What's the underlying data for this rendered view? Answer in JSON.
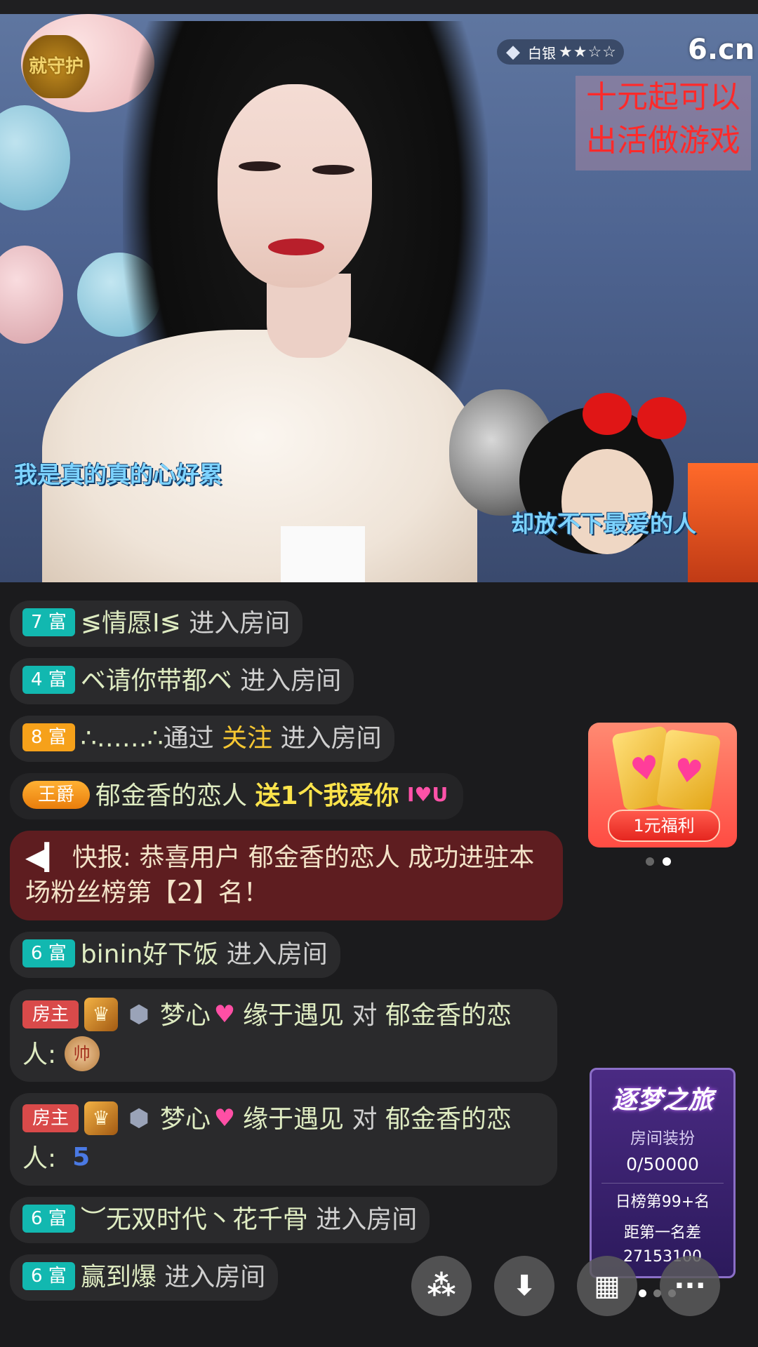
{
  "video": {
    "logo_text": "就守护",
    "rank_label": "白银",
    "rank_stars": "★★☆☆",
    "site": "6.cn",
    "promo_line1": "十元起可以",
    "promo_line2": "出活做游戏",
    "lyric_left": "我是真的真的心好累",
    "lyric_right": "却放不下最爱的人"
  },
  "chat": {
    "m1": {
      "level": "7 富",
      "user": "≶情愿I≶",
      "action": "进入房间"
    },
    "m2": {
      "level": "4 富",
      "user": "ベ请你带都ベ",
      "action": "进入房间"
    },
    "m3": {
      "level": "8 富",
      "user": "∴……∴",
      "via": "通过",
      "source": "关注",
      "action": "进入房间"
    },
    "m4": {
      "title": "王爵",
      "user": "郁金香的恋人",
      "gift": "送1个我爱你",
      "gift_icon": "I♥U"
    },
    "m5": {
      "icon": "◀▎",
      "text": "快报: 恭喜用户 郁金香的恋人 成功进驻本场粉丝榜第【2】名！"
    },
    "m6": {
      "level": "6 富",
      "user": "binin好下饭",
      "action": "进入房间"
    },
    "m7": {
      "role": "房主",
      "user": "梦心",
      "user2": "缘于遇见",
      "to": "对",
      "target": "郁金香的恋人:",
      "gift_glyph": "帅"
    },
    "m8": {
      "role": "房主",
      "user": "梦心",
      "user2": "缘于遇见",
      "to": "对",
      "target": "郁金香的恋人:",
      "gift_glyph": "5"
    },
    "m9": {
      "level": "6 富",
      "user": "︶无双时代丶花千骨",
      "action": "进入房间"
    },
    "m10": {
      "level": "6 富",
      "user": "赢到爆",
      "action": "进入房间"
    }
  },
  "welfare": {
    "label": "1元福利"
  },
  "dream": {
    "title": "逐梦之旅",
    "subtitle": "房间装扮",
    "progress": "0/50000",
    "rank": "日榜第99+名",
    "gap_label": "距第一名差",
    "gap_value": "27153100"
  },
  "icons": {
    "gift": "sparkle-icon",
    "download": "download-icon",
    "grid": "grid-icon",
    "more": "more-icon"
  },
  "colors": {
    "level_teal": "#12b8b0",
    "level_orange": "#f6a11a",
    "flash_bg": "#5e1d20",
    "host_red": "#d94a4a"
  }
}
